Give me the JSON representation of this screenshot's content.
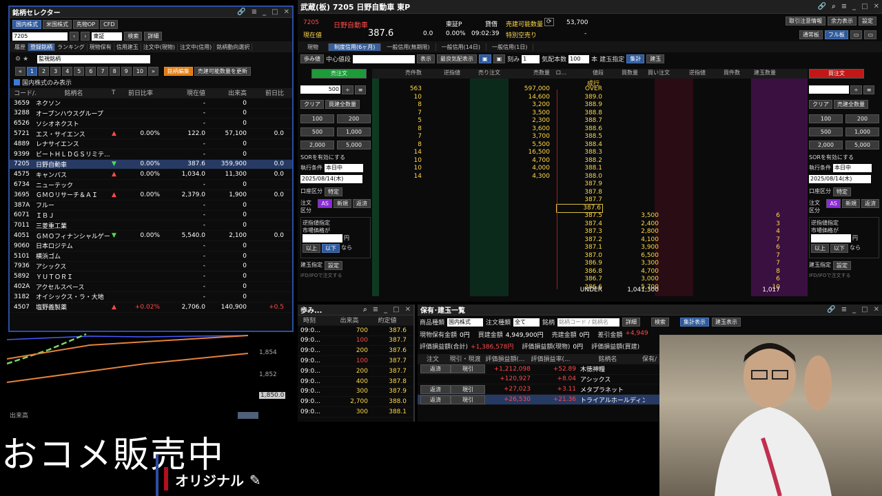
{
  "selector": {
    "title": "銘柄セレクター",
    "tabs": [
      "国内株式",
      "米国株式",
      "先物OP",
      "CFD"
    ],
    "code": "7205",
    "market": "東証",
    "search": "検索",
    "detail": "詳細",
    "subtabs": [
      "履歴",
      "登録銘柄",
      "ランキング",
      "現物保有",
      "信用建玉",
      "注文中(現物)",
      "注文中(信用)",
      "銘柄動向選択"
    ],
    "list_name": "監視銘柄",
    "pages": [
      "1",
      "2",
      "3",
      "4",
      "5",
      "6",
      "7",
      "8",
      "9",
      "10"
    ],
    "edit": "銘柄編集",
    "update": "売建可能数量を更新",
    "domestic_only": "国内株式のみ表示",
    "columns": [
      "コード/...",
      "銘柄名",
      "T",
      "前日比率",
      "現在値",
      "出来高",
      "前日比"
    ],
    "rows": [
      {
        "code": "3659",
        "name": "ネクソン",
        "t": "",
        "pct": "",
        "price": "-",
        "vol": "0",
        "chg": ""
      },
      {
        "code": "3288",
        "name": "オープンハウスグループ",
        "t": "",
        "pct": "",
        "price": "-",
        "vol": "0",
        "chg": ""
      },
      {
        "code": "6526",
        "name": "ソシオネクスト",
        "t": "",
        "pct": "",
        "price": "-",
        "vol": "0",
        "chg": ""
      },
      {
        "code": "5721",
        "name": "エス・サイエンス",
        "t": "▲",
        "pct": "0.00%",
        "price": "122.0",
        "vol": "57,100",
        "chg": "0.0"
      },
      {
        "code": "4889",
        "name": "レナサイエンス",
        "t": "",
        "pct": "",
        "price": "-",
        "vol": "0",
        "chg": ""
      },
      {
        "code": "9399",
        "name": "ビートＨＬＤＧＳリミテ...",
        "t": "",
        "pct": "",
        "price": "-",
        "vol": "0",
        "chg": ""
      },
      {
        "code": "7205",
        "name": "日野自動車",
        "t": "▼",
        "pct": "0.00%",
        "price": "387.6",
        "vol": "359,900",
        "chg": "0.0"
      },
      {
        "code": "4575",
        "name": "キャンバス",
        "t": "▲",
        "pct": "0.00%",
        "price": "1,034.0",
        "vol": "11,300",
        "chg": "0.0"
      },
      {
        "code": "6734",
        "name": "ニューテック",
        "t": "",
        "pct": "",
        "price": "-",
        "vol": "0",
        "chg": ""
      },
      {
        "code": "3695",
        "name": "ＧＭＯリサーチ＆ＡＩ",
        "t": "▲",
        "pct": "0.00%",
        "price": "2,379.0",
        "vol": "1,900",
        "chg": "0.0"
      },
      {
        "code": "387A",
        "name": "フルー",
        "t": "",
        "pct": "",
        "price": "-",
        "vol": "0",
        "chg": ""
      },
      {
        "code": "6071",
        "name": "ＩＢＪ",
        "t": "",
        "pct": "",
        "price": "-",
        "vol": "0",
        "chg": ""
      },
      {
        "code": "7011",
        "name": "三菱重工業",
        "t": "",
        "pct": "",
        "price": "-",
        "vol": "0",
        "chg": ""
      },
      {
        "code": "4051",
        "name": "ＧＭＯフィナンシャルゲート",
        "t": "▼",
        "pct": "0.00%",
        "price": "5,540.0",
        "vol": "2,100",
        "chg": "0.0"
      },
      {
        "code": "9060",
        "name": "日本ロジテム",
        "t": "",
        "pct": "",
        "price": "-",
        "vol": "0",
        "chg": ""
      },
      {
        "code": "5101",
        "name": "横浜ゴム",
        "t": "",
        "pct": "",
        "price": "-",
        "vol": "0",
        "chg": ""
      },
      {
        "code": "7936",
        "name": "アシックス",
        "t": "",
        "pct": "",
        "price": "-",
        "vol": "0",
        "chg": ""
      },
      {
        "code": "5892",
        "name": "ＹＵＴＯＲＩ",
        "t": "",
        "pct": "",
        "price": "-",
        "vol": "0",
        "chg": ""
      },
      {
        "code": "402A",
        "name": "アクセルスペース",
        "t": "",
        "pct": "",
        "price": "-",
        "vol": "0",
        "chg": ""
      },
      {
        "code": "3182",
        "name": "オイシックス・ラ・大地",
        "t": "",
        "pct": "",
        "price": "-",
        "vol": "0",
        "chg": ""
      },
      {
        "code": "4507",
        "name": "塩野義製薬",
        "t": "▲",
        "pct": "+0.02%",
        "price": "2,706.0",
        "vol": "140,900",
        "chg": "+0.5"
      }
    ]
  },
  "chart": {
    "ticks": [
      "1,854",
      "1,852",
      "1,850.0"
    ],
    "vol_label": "出来高"
  },
  "board": {
    "title": "武蔵(板) 7205 日野自動車 東P",
    "code": "7205",
    "name": "日野自動車",
    "market": "東証P",
    "genzai": "現在値",
    "price": "387.6",
    "chg": "0.0",
    "pct": "0.00%",
    "time": "09:02:39",
    "kashaku": "貸借",
    "uri_label": "売建可能数量",
    "uri_qty": "53,700",
    "tokubetsu": "特別空売り",
    "tokubetsu_val": "-",
    "top_btns": [
      "取引注意情報",
      "余力表示",
      "設定"
    ],
    "mode_btns": [
      "通常板",
      "フル板"
    ],
    "tabs": [
      "現物",
      "制度信用(6ヶ月)",
      "一般信用(無期限)",
      "一般信用(14日)",
      "一般信用(1日)"
    ],
    "tools": [
      "歩み値",
      "中心値段",
      "表示",
      "最良気配表示",
      "刻み",
      "1",
      "気配本数",
      "100",
      "本",
      "建玉指定",
      "集計",
      "建玉"
    ],
    "sell_head": "売注文",
    "buy_head": "買注文",
    "cols": [
      "売件数",
      "逆指値",
      "売り注文",
      "売数量",
      "ロ...",
      "値段",
      "買数量",
      "買い注文",
      "逆指値",
      "買件数",
      "建玉数量"
    ],
    "asks": [
      {
        "cnt": "563",
        "qty": "597,000",
        "price": "OVER"
      },
      {
        "cnt": "10",
        "qty": "14,600",
        "price": "389.0"
      },
      {
        "cnt": "8",
        "qty": "3,200",
        "price": "388.9"
      },
      {
        "cnt": "7",
        "qty": "3,500",
        "price": "388.8"
      },
      {
        "cnt": "5",
        "qty": "2,300",
        "price": "388.7"
      },
      {
        "cnt": "8",
        "qty": "3,600",
        "price": "388.6"
      },
      {
        "cnt": "7",
        "qty": "3,700",
        "price": "388.5"
      },
      {
        "cnt": "8",
        "qty": "5,500",
        "price": "388.4"
      },
      {
        "cnt": "14",
        "qty": "16,500",
        "price": "388.3"
      },
      {
        "cnt": "10",
        "qty": "4,700",
        "price": "388.2"
      },
      {
        "cnt": "10",
        "qty": "4,000",
        "price": "388.1"
      },
      {
        "cnt": "14",
        "qty": "4,300",
        "price": "388.0"
      }
    ],
    "mids": [
      "387.9",
      "387.8",
      "387.7",
      "387.6"
    ],
    "bids": [
      {
        "price": "387.5",
        "qty": "3,500",
        "cnt": "6"
      },
      {
        "price": "387.4",
        "qty": "2,400",
        "cnt": "3"
      },
      {
        "price": "387.3",
        "qty": "2,800",
        "cnt": "4"
      },
      {
        "price": "387.2",
        "qty": "4,100",
        "cnt": "7"
      },
      {
        "price": "387.1",
        "qty": "3,900",
        "cnt": "6"
      },
      {
        "price": "387.0",
        "qty": "6,500",
        "cnt": "7"
      },
      {
        "price": "386.9",
        "qty": "3,300",
        "cnt": "7"
      },
      {
        "price": "386.8",
        "qty": "4,700",
        "cnt": "8"
      },
      {
        "price": "386.7",
        "qty": "3,000",
        "cnt": "6"
      },
      {
        "price": "386.6",
        "qty": "5,700",
        "cnt": "10"
      }
    ],
    "nariyuki": "成行",
    "under": "UNDER",
    "under_qty": "1,041,300",
    "under_cnt": "1,017",
    "qty": "500",
    "clear": "クリア",
    "all_qty": "買建全数量",
    "all_qty_sell": "売建全数量",
    "qbtns": [
      "100",
      "200",
      "500",
      "1,000",
      "2,000",
      "5,000"
    ],
    "sor": "SORを有効にする",
    "exec": "執行条件",
    "exec_val": "本日中",
    "date": "2025/08/14(木)",
    "account": "口座区分",
    "tokutei": "特定",
    "order_kind": "注文区分",
    "kind_opts": [
      "AS",
      "新規",
      "返済"
    ],
    "stop": "逆指値指定",
    "market_price": "市場価格が",
    "yen": "円",
    "ijou": "以上",
    "ika": "以下",
    "nara": "なら",
    "tategyoku": "建玉指定",
    "settei": "設定",
    "ifd": "IFD/IFOで注文する"
  },
  "ticks": {
    "title": "歩み...",
    "cols": [
      "時刻",
      "出来高",
      "約定値"
    ],
    "rows": [
      [
        "09:0...",
        "700",
        "387.6"
      ],
      [
        "09:0...",
        "100",
        "387.7"
      ],
      [
        "09:0...",
        "200",
        "387.6"
      ],
      [
        "09:0...",
        "100",
        "387.7"
      ],
      [
        "09:0...",
        "200",
        "387.7"
      ],
      [
        "09:0...",
        "400",
        "387.8"
      ],
      [
        "09:0...",
        "300",
        "387.9"
      ],
      [
        "09:0...",
        "2,700",
        "388.0"
      ],
      [
        "09:0...",
        "300",
        "388.1"
      ]
    ]
  },
  "holdings": {
    "title": "保有･建玉一覧",
    "type_label": "商品種類",
    "type_val": "国内株式",
    "order_label": "注文種類",
    "order_val": "全て",
    "meigara": "銘柄",
    "search_ph": "銘柄コード / 銘柄名",
    "detail": "詳細",
    "search": "検索",
    "agg": "集計表示",
    "tate": "建玉表示",
    "genbutsu": "現物保有金額",
    "genbutsu_val": "0円",
    "kaidate": "買建金額",
    "kaidate_val": "4,949,900円",
    "uridate": "売建金額",
    "uridate_val": "0円",
    "sashihiki": "差引金額",
    "sashihiki_val": "+4,949",
    "hyoka_total": "評価損益額(合計)",
    "hyoka_total_val": "+1,386,578円",
    "hyoka_gen": "評価損益額(現物)",
    "hyoka_gen_val": "0円",
    "hyoka_ura": "評価損益額(買建)",
    "cols": [
      "注文",
      "現引・現渡",
      "評価損益額(...",
      "評価損益率(...",
      "銘柄名",
      "保有/"
    ],
    "rows": [
      {
        "btn": "返済",
        "btn2": "現引",
        "amt": "+1,212,098",
        "rate": "+52.89",
        "name": "木徳神糧"
      },
      {
        "btn": "",
        "btn2": "",
        "amt": "+120,927",
        "rate": "+8.04",
        "name": "アシックス"
      },
      {
        "btn": "返済",
        "btn2": "現引",
        "amt": "+27,023",
        "rate": "+3.11",
        "name": "メタプラネット"
      },
      {
        "btn": "返済",
        "btn2": "現引",
        "amt": "+26,530",
        "rate": "+21.36",
        "name": "トライアルホールディン..."
      }
    ]
  },
  "overlay": {
    "banner": "おコメ販売中",
    "original": "オリジナル"
  }
}
